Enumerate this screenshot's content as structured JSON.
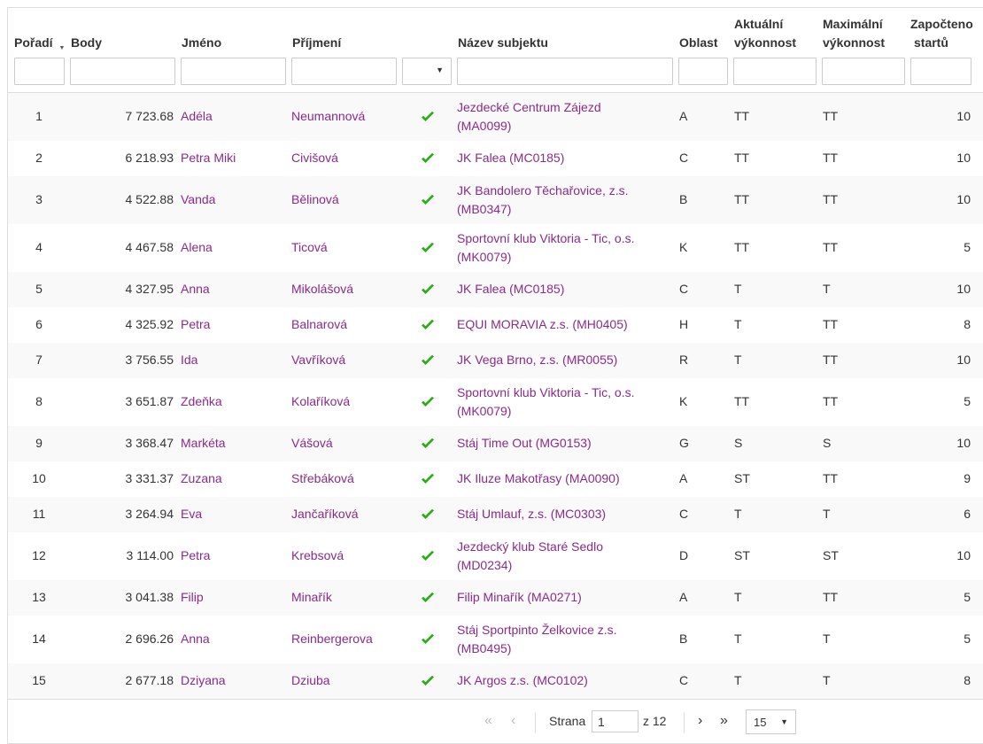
{
  "header": {
    "poradi": "Pořadí",
    "body": "Body",
    "jmeno": "Jméno",
    "prijmeni": "Příjmení",
    "nazev": "Název subjektu",
    "oblast": "Oblast",
    "aktualni_1": "Aktuální",
    "aktualni_2": "výkonnost",
    "maximalni_1": "Maximální",
    "maximalni_2": "výkonnost",
    "zapocteno_1": "Započteno",
    "zapocteno_2": "startů",
    "sort_indicator": "▼",
    "select_arrow": "▼"
  },
  "rows": [
    {
      "rank": "1",
      "points": "7 723.68",
      "first": "Adéla",
      "last": "Neumannová",
      "subject": [
        "Jezdecké Centrum Zájezd",
        "(MA0099)"
      ],
      "area": "A",
      "current": "TT",
      "max": "TT",
      "starts": "10"
    },
    {
      "rank": "2",
      "points": "6 218.93",
      "first": "Petra  Miki",
      "last": "Civišová",
      "subject": [
        "JK Falea (MC0185)"
      ],
      "area": "C",
      "current": "TT",
      "max": "TT",
      "starts": "10"
    },
    {
      "rank": "3",
      "points": "4 522.88",
      "first": "Vanda",
      "last": "Bělinová",
      "subject": [
        "JK Bandolero Těchařovice, z.s.",
        "(MB0347)"
      ],
      "area": "B",
      "current": "TT",
      "max": "TT",
      "starts": "10"
    },
    {
      "rank": "4",
      "points": "4 467.58",
      "first": "Alena",
      "last": "Ticová",
      "subject": [
        "Sportovní klub Viktoria - Tic, o.s.",
        "(MK0079)"
      ],
      "area": "K",
      "current": "TT",
      "max": "TT",
      "starts": "5"
    },
    {
      "rank": "5",
      "points": "4 327.95",
      "first": "Anna",
      "last": "Mikolášová",
      "subject": [
        "JK Falea (MC0185)"
      ],
      "area": "C",
      "current": "T",
      "max": "T",
      "starts": "10"
    },
    {
      "rank": "6",
      "points": "4 325.92",
      "first": "Petra",
      "last": "Balnarová",
      "subject": [
        "EQUI MORAVIA z.s. (MH0405)"
      ],
      "area": "H",
      "current": "T",
      "max": "TT",
      "starts": "8"
    },
    {
      "rank": "7",
      "points": "3 756.55",
      "first": "Ida",
      "last": "Vavříková",
      "subject": [
        "JK Vega Brno, z.s. (MR0055)"
      ],
      "area": "R",
      "current": "T",
      "max": "TT",
      "starts": "10"
    },
    {
      "rank": "8",
      "points": "3 651.87",
      "first": "Zdeňka",
      "last": "Kolaříková",
      "subject": [
        "Sportovní klub Viktoria - Tic, o.s.",
        "(MK0079)"
      ],
      "area": "K",
      "current": "TT",
      "max": "TT",
      "starts": "5"
    },
    {
      "rank": "9",
      "points": "3 368.47",
      "first": "Markéta",
      "last": "Vášová",
      "subject": [
        "Stáj Time Out (MG0153)"
      ],
      "area": "G",
      "current": "S",
      "max": "S",
      "starts": "10"
    },
    {
      "rank": "10",
      "points": "3 331.37",
      "first": "Zuzana",
      "last": "Střebáková",
      "subject": [
        "JK Iluze Makotřasy (MA0090)"
      ],
      "area": "A",
      "current": "ST",
      "max": "TT",
      "starts": "9"
    },
    {
      "rank": "11",
      "points": "3 264.94",
      "first": "Eva",
      "last": "Jančaříková",
      "subject": [
        "Stáj Umlauf, z.s. (MC0303)"
      ],
      "area": "C",
      "current": "T",
      "max": "T",
      "starts": "6"
    },
    {
      "rank": "12",
      "points": "3 114.00",
      "first": "Petra",
      "last": "Krebsová",
      "subject": [
        "Jezdecký klub Staré Sedlo",
        "(MD0234)"
      ],
      "area": "D",
      "current": "ST",
      "max": "ST",
      "starts": "10"
    },
    {
      "rank": "13",
      "points": "3 041.38",
      "first": "Filip",
      "last": "Minařík",
      "subject": [
        "Filip Minařík (MA0271)"
      ],
      "area": "A",
      "current": "T",
      "max": "TT",
      "starts": "5"
    },
    {
      "rank": "14",
      "points": "2 696.26",
      "first": "Anna",
      "last": "Reinbergerova",
      "subject": [
        "Stáj Sportpinto Želkovice z.s.",
        "(MB0495)"
      ],
      "area": "B",
      "current": "T",
      "max": "T",
      "starts": "5"
    },
    {
      "rank": "15",
      "points": "2 677.18",
      "first": "Dziyana",
      "last": "Dziuba",
      "subject": [
        "JK Argos  z.s. (MC0102)"
      ],
      "area": "C",
      "current": "T",
      "max": "T",
      "starts": "8"
    }
  ],
  "pager": {
    "first": "«",
    "prev": "‹",
    "next": "›",
    "last": "»",
    "page_label": "Strana",
    "page_value": "1",
    "of_label": "z 12",
    "page_size": "15",
    "page_size_arrow": "▼"
  },
  "colors": {
    "link": "#8b2a8b",
    "check": "#27ae14",
    "row_alt": "#f9f9f9",
    "border": "#dddddd"
  }
}
